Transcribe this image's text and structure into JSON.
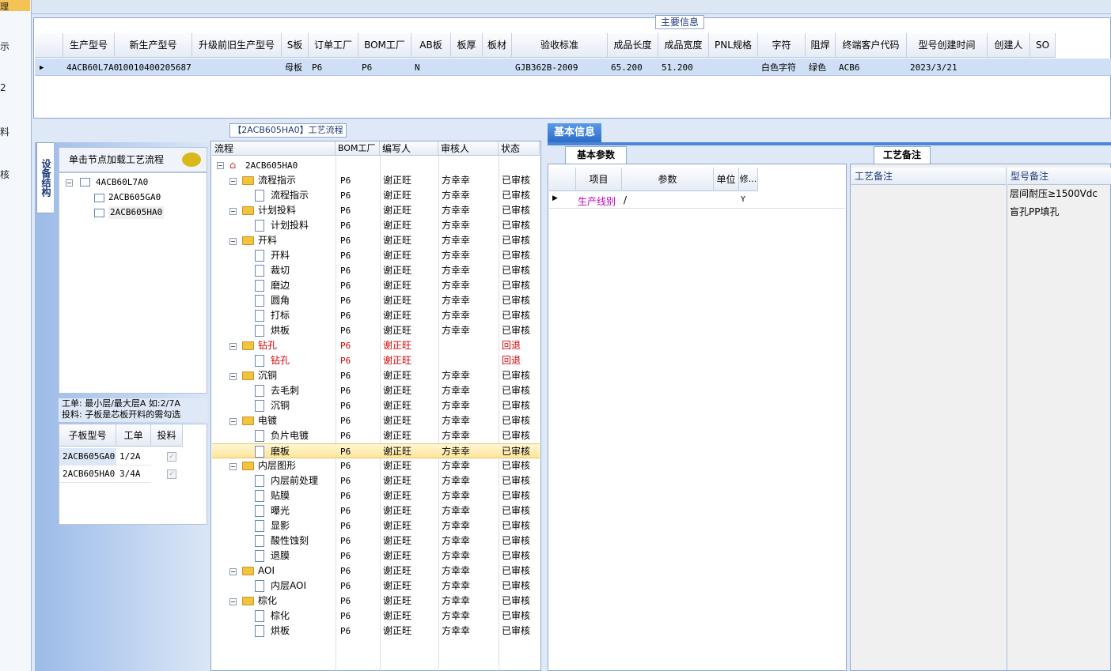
{
  "left_strip": [
    "理",
    "示",
    "2",
    "料",
    "核"
  ],
  "main_info": {
    "title": "主要信息",
    "columns": [
      "生产型号",
      "新生产型号",
      "升级前旧生产型号",
      "S板",
      "订单工厂",
      "BOM工厂",
      "AB板",
      "板厚",
      "板材",
      "验收标准",
      "成品长度",
      "成品宽度",
      "PNL规格",
      "字符",
      "阻焊",
      "终端客户代码",
      "型号创建时间",
      "创建人",
      "SO"
    ],
    "row": [
      "4ACB60L7A0",
      "10010400205687",
      "",
      "母板",
      "P6",
      "P6",
      "N",
      "",
      "",
      "GJB362B-2009",
      "65.200",
      "51.200",
      "",
      "白色字符",
      "绿色",
      "ACB6",
      "2023/3/21",
      "",
      ""
    ]
  },
  "device": {
    "tab_label": "设备结构",
    "hint": "单击节点加载工艺流程",
    "tree": [
      "4ACB60L7A0",
      "2ACB605GA0",
      "2ACB605HA0"
    ],
    "memo_line1": "工单: 最小层/最大层A 如:2/7A",
    "memo_line2": "投料: 子板是芯板开料的需勾选",
    "sub_columns": [
      "子板型号",
      "工单",
      "投料"
    ],
    "sub_rows": [
      {
        "model": "2ACB605GA0",
        "order": "1/2A"
      },
      {
        "model": "2ACB605HA0",
        "order": "3/4A"
      }
    ]
  },
  "flow": {
    "title": "【2ACB605HA0】工艺流程",
    "columns": [
      "流程",
      "BOM工厂",
      "编写人",
      "审核人",
      "状态"
    ],
    "root": "2ACB605HA0",
    "rows": [
      {
        "name": "流程指示",
        "type": "folder",
        "bom": "P6",
        "writer": "谢正旺",
        "reviewer": "方幸幸",
        "status": "已审核"
      },
      {
        "name": "流程指示",
        "type": "doc",
        "bom": "P6",
        "writer": "谢正旺",
        "reviewer": "方幸幸",
        "status": "已审核"
      },
      {
        "name": "计划投料",
        "type": "folder",
        "bom": "P6",
        "writer": "谢正旺",
        "reviewer": "方幸幸",
        "status": "已审核"
      },
      {
        "name": "计划投料",
        "type": "doc",
        "bom": "P6",
        "writer": "谢正旺",
        "reviewer": "方幸幸",
        "status": "已审核"
      },
      {
        "name": "开料",
        "type": "folder",
        "bom": "P6",
        "writer": "谢正旺",
        "reviewer": "方幸幸",
        "status": "已审核"
      },
      {
        "name": "开料",
        "type": "doc",
        "bom": "P6",
        "writer": "谢正旺",
        "reviewer": "方幸幸",
        "status": "已审核"
      },
      {
        "name": "裁切",
        "type": "doc",
        "bom": "P6",
        "writer": "谢正旺",
        "reviewer": "方幸幸",
        "status": "已审核"
      },
      {
        "name": "磨边",
        "type": "doc",
        "bom": "P6",
        "writer": "谢正旺",
        "reviewer": "方幸幸",
        "status": "已审核"
      },
      {
        "name": "圆角",
        "type": "doc",
        "bom": "P6",
        "writer": "谢正旺",
        "reviewer": "方幸幸",
        "status": "已审核"
      },
      {
        "name": "打标",
        "type": "doc",
        "bom": "P6",
        "writer": "谢正旺",
        "reviewer": "方幸幸",
        "status": "已审核"
      },
      {
        "name": "烘板",
        "type": "doc",
        "bom": "P6",
        "writer": "谢正旺",
        "reviewer": "方幸幸",
        "status": "已审核"
      },
      {
        "name": "钻孔",
        "type": "folder",
        "bom": "P6",
        "writer": "谢正旺",
        "reviewer": "",
        "status": "回退",
        "red": true
      },
      {
        "name": "钻孔",
        "type": "doc",
        "bom": "P6",
        "writer": "谢正旺",
        "reviewer": "",
        "status": "回退",
        "red": true
      },
      {
        "name": "沉铜",
        "type": "folder",
        "bom": "P6",
        "writer": "谢正旺",
        "reviewer": "方幸幸",
        "status": "已审核"
      },
      {
        "name": "去毛刺",
        "type": "doc",
        "bom": "P6",
        "writer": "谢正旺",
        "reviewer": "方幸幸",
        "status": "已审核"
      },
      {
        "name": "沉铜",
        "type": "doc",
        "bom": "P6",
        "writer": "谢正旺",
        "reviewer": "方幸幸",
        "status": "已审核"
      },
      {
        "name": "电镀",
        "type": "folder",
        "bom": "P6",
        "writer": "谢正旺",
        "reviewer": "方幸幸",
        "status": "已审核"
      },
      {
        "name": "负片电镀",
        "type": "doc",
        "bom": "P6",
        "writer": "谢正旺",
        "reviewer": "方幸幸",
        "status": "已审核"
      },
      {
        "name": "磨板",
        "type": "doc",
        "bom": "P6",
        "writer": "谢正旺",
        "reviewer": "方幸幸",
        "status": "已审核",
        "selected": true
      },
      {
        "name": "内层图形",
        "type": "folder",
        "bom": "P6",
        "writer": "谢正旺",
        "reviewer": "方幸幸",
        "status": "已审核"
      },
      {
        "name": "内层前处理",
        "type": "doc",
        "bom": "P6",
        "writer": "谢正旺",
        "reviewer": "方幸幸",
        "status": "已审核"
      },
      {
        "name": "贴膜",
        "type": "doc",
        "bom": "P6",
        "writer": "谢正旺",
        "reviewer": "方幸幸",
        "status": "已审核"
      },
      {
        "name": "曝光",
        "type": "doc",
        "bom": "P6",
        "writer": "谢正旺",
        "reviewer": "方幸幸",
        "status": "已审核"
      },
      {
        "name": "显影",
        "type": "doc",
        "bom": "P6",
        "writer": "谢正旺",
        "reviewer": "方幸幸",
        "status": "已审核"
      },
      {
        "name": "酸性蚀刻",
        "type": "doc",
        "bom": "P6",
        "writer": "谢正旺",
        "reviewer": "方幸幸",
        "status": "已审核"
      },
      {
        "name": "退膜",
        "type": "doc",
        "bom": "P6",
        "writer": "谢正旺",
        "reviewer": "方幸幸",
        "status": "已审核"
      },
      {
        "name": "AOI",
        "type": "folder",
        "bom": "P6",
        "writer": "谢正旺",
        "reviewer": "方幸幸",
        "status": "已审核"
      },
      {
        "name": "内层AOI",
        "type": "doc",
        "bom": "P6",
        "writer": "谢正旺",
        "reviewer": "方幸幸",
        "status": "已审核"
      },
      {
        "name": "棕化",
        "type": "folder",
        "bom": "P6",
        "writer": "谢正旺",
        "reviewer": "方幸幸",
        "status": "已审核"
      },
      {
        "name": "棕化",
        "type": "doc",
        "bom": "P6",
        "writer": "谢正旺",
        "reviewer": "方幸幸",
        "status": "已审核"
      },
      {
        "name": "烘板",
        "type": "doc",
        "bom": "P6",
        "writer": "谢正旺",
        "reviewer": "方幸幸",
        "status": "已审核"
      }
    ]
  },
  "basic_info": {
    "tab": "基本信息",
    "param_tab": "基本参数",
    "param_columns": [
      "项目",
      "参数",
      "单位",
      "修..."
    ],
    "param_row": {
      "item": "生产线别",
      "value": "/",
      "unit": "",
      "mod": "Y"
    },
    "remark_tab": "工艺备注",
    "remark_columns": [
      "工艺备注",
      "型号备注"
    ],
    "model_remarks": [
      "层间耐压≥1500Vdc",
      "盲孔PP填孔"
    ]
  },
  "colors": {
    "accent": "#2d6cc8",
    "selected_row": "#fde59a",
    "rollback": "#d40000",
    "param_item": "#c000c0"
  }
}
